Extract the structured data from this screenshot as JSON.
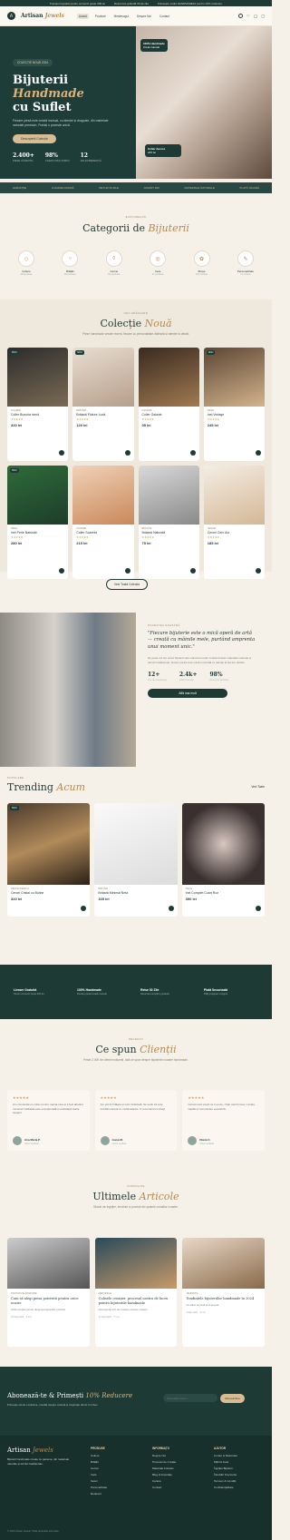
{
  "topbar": {
    "items": [
      "Transport gratuit pentru comenzi peste 300 lei",
      "Garanție pe viață",
      "Returnare gratuită 30 de zile",
      "Folosește codul HANDMADE10 pentru 10% reducere"
    ]
  },
  "header": {
    "logo_mark": "A",
    "logo_text": "Artisan",
    "logo_accent": "Jewels",
    "nav": [
      "Acasă",
      "Produse",
      "Meșteșugul",
      "Despre Noi",
      "Contact"
    ]
  },
  "hero": {
    "pill": "COLECȚIE NOUĂ 2024",
    "title": "Bijuterii",
    "title_accent": "Handmade",
    "title_line2": "cu Suflet",
    "desc": "Fiecare piesă este creată manual, cu atenție și dragoste, din materiale naturale premium. Purtați o poveste unică.",
    "cta": "Descoperă Colecția",
    "stats": [
      {
        "v": "2.400+",
        "l": "PIESE VÂNDUTE"
      },
      {
        "v": "98%",
        "l": "CLIENȚI MULȚUMIȚI"
      },
      {
        "v": "12",
        "l": "ANI EXPERIENȚĂ"
      }
    ],
    "tag1": "100% Handmade",
    "tag1_sub": "Creat manual",
    "tag2": "Colier Aurora",
    "tag2_sub": "245 lei"
  },
  "strip": [
    "GARANȚIE",
    "LIVRARE RAPIDĂ",
    "RETUR 30 ZILE",
    "ARGINT 925",
    "MATERIALE NATURALE",
    "PLATĂ SIGURĂ"
  ],
  "categories": {
    "kicker": "EXPLOREAZĂ",
    "title": "Categorii de",
    "title_accent": "Bijuterii",
    "items": [
      {
        "n": "Coliere",
        "c": "48 produse"
      },
      {
        "n": "Brățări",
        "c": "36 produse"
      },
      {
        "n": "Cercei",
        "c": "52 produse"
      },
      {
        "n": "Inele",
        "c": "41 produse"
      },
      {
        "n": "Broșe",
        "c": "18 produse"
      },
      {
        "n": "Personalizate",
        "c": "La cerere"
      }
    ]
  },
  "collection": {
    "kicker": "NOU ADĂUGATE",
    "title": "Colecție",
    "title_accent": "Nouă",
    "sub": "Piese handmade create recent, fiecare cu personalitate distinctă și atenție la detalii.",
    "cta": "Vezi Toată Colecția",
    "products": [
      {
        "cat": "COLIERE",
        "name": "Colier Bucuria Iarnă",
        "stars": "★★★★★",
        "price": "320 lei"
      },
      {
        "cat": "BRĂȚĂRI",
        "name": "Brățară Fluture Lună",
        "stars": "★★★★★",
        "price": "120 lei"
      },
      {
        "cat": "COLIERE",
        "name": "Colier Galaxie",
        "stars": "★★★★★",
        "price": "95 lei"
      },
      {
        "cat": "INELE",
        "name": "Inel Vintage",
        "stars": "★★★★★",
        "price": "245 lei"
      },
      {
        "cat": "INELE",
        "name": "Inel Perle Naturale",
        "stars": "★★★★★",
        "price": "280 lei"
      },
      {
        "cat": "COLIERE",
        "name": "Colier Soarelui",
        "stars": "★★★★★",
        "price": "210 lei"
      },
      {
        "cat": "BRĂȚĂRI",
        "name": "Brățară Naturală",
        "stars": "★★★★★",
        "price": "75 lei"
      },
      {
        "cat": "CERCEI",
        "name": "Cercei Cerc Aur",
        "stars": "★★★★★",
        "price": "185 lei"
      }
    ]
  },
  "story": {
    "kicker": "POVESTEA NOASTRĂ",
    "quote": "\"Fiecare bijuterie este o mică operă de artă — creată cu mâinile mele, purtând amprenta unui moment unic.\"",
    "text": "De peste 12 ani creez bijuterii care transmit emoții. Folosind doar materiale naturale și tehnici tradiționale, fiecare piesă este unică și lucrată cu atenție la fiecare detaliu.",
    "stats": [
      {
        "v": "12+",
        "l": "Ani de meșteșug"
      },
      {
        "v": "2.4k+",
        "l": "Clienți fericiți"
      },
      {
        "v": "98%",
        "l": "Recenzii pozitive"
      }
    ],
    "cta": "Află mai mult"
  },
  "trending": {
    "kicker": "POPULARE",
    "title": "Trending",
    "title_accent": "Acum",
    "link": "Vezi Toate",
    "products": [
      {
        "cat": "CERCEI PENDUL",
        "name": "Cercei Cristal cu Buline",
        "price": "320 lei"
      },
      {
        "cat": "BRĂȚĂRI",
        "name": "Brățară Minimal Neta",
        "price": "165 lei"
      },
      {
        "cat": "INELE",
        "name": "Inel Complet Cuarț Roz",
        "price": "390 lei"
      }
    ]
  },
  "features": [
    {
      "t": "Livrare Gratuită",
      "s": "Pentru comenzi peste 300 lei"
    },
    {
      "t": "100% Handmade",
      "s": "Fiecare piesă creată manual"
    },
    {
      "t": "Retur 30 Zile",
      "s": "Returnare simplă și gratuită"
    },
    {
      "t": "Plată Securizată",
      "s": "Plăți protejate și sigure"
    }
  ],
  "reviews": {
    "kicker": "RECENZII",
    "title": "Ce spun",
    "title_accent": "Clienții",
    "sub": "Peste 2.400 de clienți mulțumiți. Iată ce spun despre bijuteriile noastre handmade.",
    "items": [
      {
        "stars": "★★★★★",
        "text": "Am comandat un colier pentru mama mea și a fost absolut minunat! Calitatea este excepțională și ambalajul foarte elegant.",
        "name": "Ana Maria P.",
        "role": "Client verificat",
        "i": "AM"
      },
      {
        "stars": "★★★★★",
        "text": "Am primit brățara și sunt încântată. Se vede că este lucrată manual cu multă atenție. O recomand cu drag!",
        "name": "Ioana M.",
        "role": "Client verificat",
        "i": "IM"
      },
      {
        "stars": "★★★★★",
        "text": "Cerceii sunt exact ca în poze, chiar mai frumoși. Livrare rapidă și comunicare excelentă.",
        "name": "Diana C.",
        "role": "Client verificat",
        "i": "DC"
      }
    ]
  },
  "blog": {
    "kicker": "INSPIRAȚIE",
    "title": "Ultimele",
    "title_accent": "Articole",
    "sub": "Sfaturi de îngrijire, tendințe și povești din spatele creațiilor noastre.",
    "posts": [
      {
        "k": "SFATURI DE ÎNGRIJIRE",
        "t": "Cum să alegi piesa potrivită pentru orice ocazie",
        "p": "Ghid complet pentru alegerea bijuteriilor potrivite.",
        "d": "18 Mai 2024 · 5 min"
      },
      {
        "k": "MEȘTEȘUG",
        "t": "Culisele creației: procesul nostru de lucru pentru bijuteriile handmade",
        "p": "Descoperă cum iau naștere piesele noastre.",
        "d": "12 Mai 2024 · 7 min"
      },
      {
        "k": "TENDINȚE",
        "t": "Tendințele bijuteriilor handmade în 2024",
        "p": "Ce stiluri domină anul acesta.",
        "d": "5 Mai 2024 · 4 min"
      }
    ]
  },
  "newsletter": {
    "title": "Abonează-te & Primești",
    "title_accent": "10% Reducere",
    "sub": "Primește oferte exclusive, noutăți despre colecții și inspirație direct în inbox.",
    "placeholder": "adresa@email.ro",
    "cta": "Abonează-te"
  },
  "footer": {
    "logo": "Artisan",
    "logo_accent": "Jewels",
    "about": "Bijuterii handmade create cu pasiune, din materiale naturale și tehnici tradiționale.",
    "cols": [
      {
        "h": "PRODUSE",
        "i": [
          "Coliere",
          "Brățări",
          "Cercei",
          "Inele",
          "Seturi",
          "Personalizate",
          "Reduceri"
        ]
      },
      {
        "h": "INFORMAȚII",
        "i": [
          "Despre Noi",
          "Procesul de Creație",
          "Materiale Folosite",
          "Blog & Inspirație",
          "Cariere",
          "Contact"
        ]
      },
      {
        "h": "AJUTOR",
        "i": [
          "Livrare & Returnare",
          "Mărimi Inele",
          "Îngrijire Bijuterii",
          "Întrebări Frecvente",
          "Termeni & Condiții",
          "Confidențialitate"
        ]
      }
    ],
    "copy": "© 2024 Artisan Jewels. Toate drepturile rezervate."
  }
}
